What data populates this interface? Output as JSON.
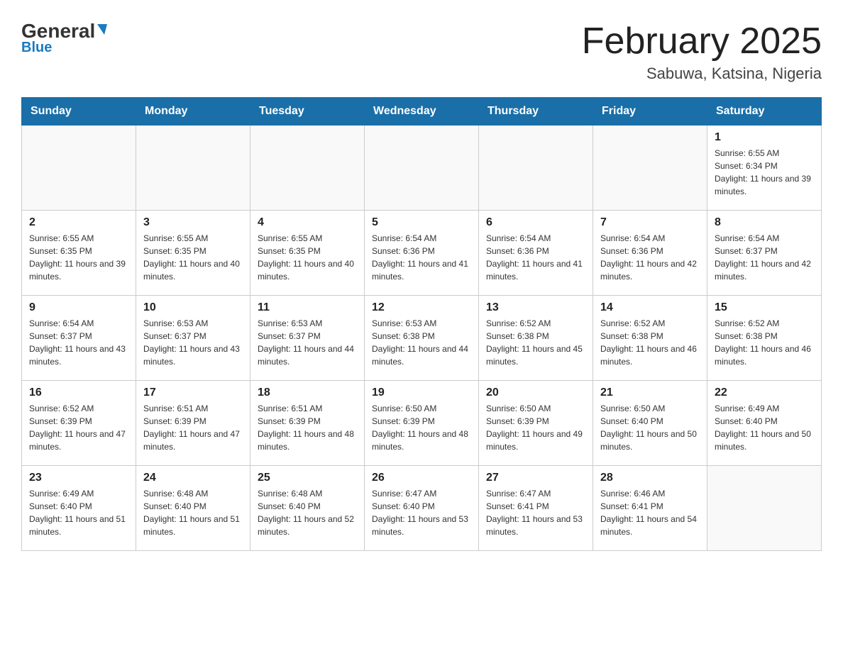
{
  "header": {
    "logo_general": "General",
    "logo_blue": "Blue",
    "title": "February 2025",
    "subtitle": "Sabuwa, Katsina, Nigeria"
  },
  "weekdays": [
    "Sunday",
    "Monday",
    "Tuesday",
    "Wednesday",
    "Thursday",
    "Friday",
    "Saturday"
  ],
  "weeks": [
    [
      {
        "day": "",
        "sunrise": "",
        "sunset": "",
        "daylight": ""
      },
      {
        "day": "",
        "sunrise": "",
        "sunset": "",
        "daylight": ""
      },
      {
        "day": "",
        "sunrise": "",
        "sunset": "",
        "daylight": ""
      },
      {
        "day": "",
        "sunrise": "",
        "sunset": "",
        "daylight": ""
      },
      {
        "day": "",
        "sunrise": "",
        "sunset": "",
        "daylight": ""
      },
      {
        "day": "",
        "sunrise": "",
        "sunset": "",
        "daylight": ""
      },
      {
        "day": "1",
        "sunrise": "Sunrise: 6:55 AM",
        "sunset": "Sunset: 6:34 PM",
        "daylight": "Daylight: 11 hours and 39 minutes."
      }
    ],
    [
      {
        "day": "2",
        "sunrise": "Sunrise: 6:55 AM",
        "sunset": "Sunset: 6:35 PM",
        "daylight": "Daylight: 11 hours and 39 minutes."
      },
      {
        "day": "3",
        "sunrise": "Sunrise: 6:55 AM",
        "sunset": "Sunset: 6:35 PM",
        "daylight": "Daylight: 11 hours and 40 minutes."
      },
      {
        "day": "4",
        "sunrise": "Sunrise: 6:55 AM",
        "sunset": "Sunset: 6:35 PM",
        "daylight": "Daylight: 11 hours and 40 minutes."
      },
      {
        "day": "5",
        "sunrise": "Sunrise: 6:54 AM",
        "sunset": "Sunset: 6:36 PM",
        "daylight": "Daylight: 11 hours and 41 minutes."
      },
      {
        "day": "6",
        "sunrise": "Sunrise: 6:54 AM",
        "sunset": "Sunset: 6:36 PM",
        "daylight": "Daylight: 11 hours and 41 minutes."
      },
      {
        "day": "7",
        "sunrise": "Sunrise: 6:54 AM",
        "sunset": "Sunset: 6:36 PM",
        "daylight": "Daylight: 11 hours and 42 minutes."
      },
      {
        "day": "8",
        "sunrise": "Sunrise: 6:54 AM",
        "sunset": "Sunset: 6:37 PM",
        "daylight": "Daylight: 11 hours and 42 minutes."
      }
    ],
    [
      {
        "day": "9",
        "sunrise": "Sunrise: 6:54 AM",
        "sunset": "Sunset: 6:37 PM",
        "daylight": "Daylight: 11 hours and 43 minutes."
      },
      {
        "day": "10",
        "sunrise": "Sunrise: 6:53 AM",
        "sunset": "Sunset: 6:37 PM",
        "daylight": "Daylight: 11 hours and 43 minutes."
      },
      {
        "day": "11",
        "sunrise": "Sunrise: 6:53 AM",
        "sunset": "Sunset: 6:37 PM",
        "daylight": "Daylight: 11 hours and 44 minutes."
      },
      {
        "day": "12",
        "sunrise": "Sunrise: 6:53 AM",
        "sunset": "Sunset: 6:38 PM",
        "daylight": "Daylight: 11 hours and 44 minutes."
      },
      {
        "day": "13",
        "sunrise": "Sunrise: 6:52 AM",
        "sunset": "Sunset: 6:38 PM",
        "daylight": "Daylight: 11 hours and 45 minutes."
      },
      {
        "day": "14",
        "sunrise": "Sunrise: 6:52 AM",
        "sunset": "Sunset: 6:38 PM",
        "daylight": "Daylight: 11 hours and 46 minutes."
      },
      {
        "day": "15",
        "sunrise": "Sunrise: 6:52 AM",
        "sunset": "Sunset: 6:38 PM",
        "daylight": "Daylight: 11 hours and 46 minutes."
      }
    ],
    [
      {
        "day": "16",
        "sunrise": "Sunrise: 6:52 AM",
        "sunset": "Sunset: 6:39 PM",
        "daylight": "Daylight: 11 hours and 47 minutes."
      },
      {
        "day": "17",
        "sunrise": "Sunrise: 6:51 AM",
        "sunset": "Sunset: 6:39 PM",
        "daylight": "Daylight: 11 hours and 47 minutes."
      },
      {
        "day": "18",
        "sunrise": "Sunrise: 6:51 AM",
        "sunset": "Sunset: 6:39 PM",
        "daylight": "Daylight: 11 hours and 48 minutes."
      },
      {
        "day": "19",
        "sunrise": "Sunrise: 6:50 AM",
        "sunset": "Sunset: 6:39 PM",
        "daylight": "Daylight: 11 hours and 48 minutes."
      },
      {
        "day": "20",
        "sunrise": "Sunrise: 6:50 AM",
        "sunset": "Sunset: 6:39 PM",
        "daylight": "Daylight: 11 hours and 49 minutes."
      },
      {
        "day": "21",
        "sunrise": "Sunrise: 6:50 AM",
        "sunset": "Sunset: 6:40 PM",
        "daylight": "Daylight: 11 hours and 50 minutes."
      },
      {
        "day": "22",
        "sunrise": "Sunrise: 6:49 AM",
        "sunset": "Sunset: 6:40 PM",
        "daylight": "Daylight: 11 hours and 50 minutes."
      }
    ],
    [
      {
        "day": "23",
        "sunrise": "Sunrise: 6:49 AM",
        "sunset": "Sunset: 6:40 PM",
        "daylight": "Daylight: 11 hours and 51 minutes."
      },
      {
        "day": "24",
        "sunrise": "Sunrise: 6:48 AM",
        "sunset": "Sunset: 6:40 PM",
        "daylight": "Daylight: 11 hours and 51 minutes."
      },
      {
        "day": "25",
        "sunrise": "Sunrise: 6:48 AM",
        "sunset": "Sunset: 6:40 PM",
        "daylight": "Daylight: 11 hours and 52 minutes."
      },
      {
        "day": "26",
        "sunrise": "Sunrise: 6:47 AM",
        "sunset": "Sunset: 6:40 PM",
        "daylight": "Daylight: 11 hours and 53 minutes."
      },
      {
        "day": "27",
        "sunrise": "Sunrise: 6:47 AM",
        "sunset": "Sunset: 6:41 PM",
        "daylight": "Daylight: 11 hours and 53 minutes."
      },
      {
        "day": "28",
        "sunrise": "Sunrise: 6:46 AM",
        "sunset": "Sunset: 6:41 PM",
        "daylight": "Daylight: 11 hours and 54 minutes."
      },
      {
        "day": "",
        "sunrise": "",
        "sunset": "",
        "daylight": ""
      }
    ]
  ]
}
